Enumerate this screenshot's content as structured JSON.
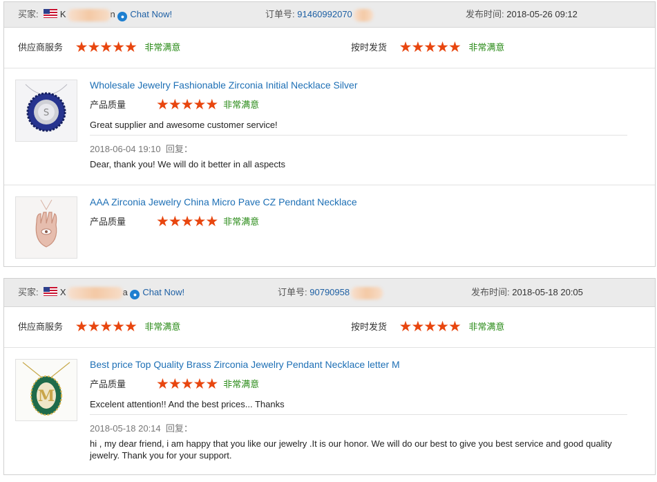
{
  "reviews": [
    {
      "buyer_label": "买家:",
      "buyer_name_visible": "K",
      "buyer_name_tail": "n",
      "chat_label": "Chat Now!",
      "order_label": "订单号:",
      "order_no": "91460992070",
      "date_label": "发布时间:",
      "date": "2018-05-26 09:12",
      "supplier_service_label": "供应商服务",
      "supplier_service_rating": "非常满意",
      "supplier_service_stars": 5,
      "on_time_label": "按时发货",
      "on_time_rating": "非常满意",
      "on_time_stars": 5,
      "items": [
        {
          "title": "Wholesale Jewelry Fashionable Zirconia Initial Necklace Silver",
          "quality_label": "产品质量",
          "quality_rating": "非常满意",
          "quality_stars": 5,
          "comment": "Great supplier and awesome customer service!",
          "reply_date": "2018-06-04 19:10",
          "reply_label": "回复：",
          "reply": "Dear, thank you! We will do it better in all aspects"
        },
        {
          "title": "AAA Zirconia Jewelry China Micro Pave CZ Pendant Necklace",
          "quality_label": "产品质量",
          "quality_rating": "非常满意",
          "quality_stars": 5
        }
      ]
    },
    {
      "buyer_label": "买家:",
      "buyer_name_visible": "X",
      "buyer_name_tail": "a",
      "chat_label": "Chat Now!",
      "order_label": "订单号:",
      "order_no": "90790958",
      "date_label": "发布时间:",
      "date": "2018-05-18 20:05",
      "supplier_service_label": "供应商服务",
      "supplier_service_rating": "非常满意",
      "supplier_service_stars": 5,
      "on_time_label": "按时发货",
      "on_time_rating": "非常满意",
      "on_time_stars": 5,
      "items": [
        {
          "title": "Best price Top Quality Brass Zirconia Jewelry Pendant Necklace letter M",
          "quality_label": "产品质量",
          "quality_rating": "非常满意",
          "quality_stars": 5,
          "comment": "Excelent attention!! And the best prices... Thanks",
          "reply_date": "2018-05-18 20:14",
          "reply_label": "回复：",
          "reply": "hi , my dear friend, i am happy that you like our jewelry .It is our honor. We will do our best to give you best service and good quality jewelry. Thank you for your support."
        }
      ]
    }
  ],
  "colors": {
    "accent_blue": "#1d6fb5",
    "star_orange": "#e8460f",
    "satisfied_green": "#2a8b18",
    "header_gray": "#ebebeb"
  },
  "icons": {
    "flag": "us-flag-icon",
    "chat": "chat-bubble-icon",
    "star": "star-icon"
  }
}
